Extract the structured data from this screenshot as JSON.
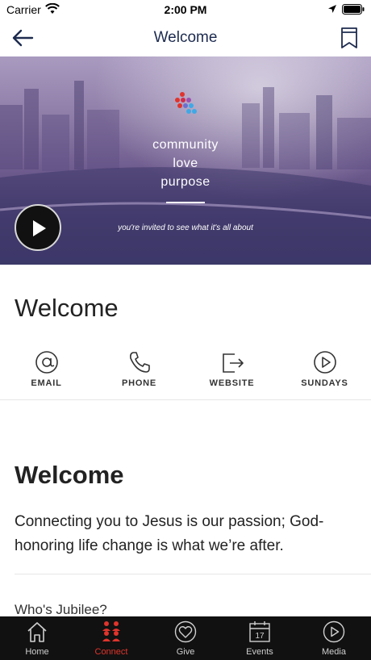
{
  "status_bar": {
    "carrier": "Carrier",
    "time": "2:00 PM"
  },
  "nav": {
    "title": "Welcome"
  },
  "hero": {
    "line1": "community",
    "line2": "love",
    "line3": "purpose",
    "invite": "you're invited to see what it's all about"
  },
  "welcome_heading": "Welcome",
  "actions": [
    {
      "label": "EMAIL",
      "icon": "at-icon"
    },
    {
      "label": "PHONE",
      "icon": "phone-icon"
    },
    {
      "label": "WEBSITE",
      "icon": "external-link-icon"
    },
    {
      "label": "SUNDAYS",
      "icon": "play-circle-icon"
    }
  ],
  "content": {
    "title": "Welcome",
    "body": "Connecting you to Jesus is our passion; God-honoring life change is what we’re after.",
    "next_heading": "Who's Jubilee?"
  },
  "tabs": [
    {
      "label": "Home",
      "icon": "home-icon",
      "active": false
    },
    {
      "label": "Connect",
      "icon": "people-icon",
      "active": true
    },
    {
      "label": "Give",
      "icon": "heart-icon",
      "active": false
    },
    {
      "label": "Events",
      "icon": "calendar-icon",
      "active": false,
      "calendar_day": "17"
    },
    {
      "label": "Media",
      "icon": "play-circle-icon",
      "active": false
    }
  ],
  "colors": {
    "accent": "#e0342c",
    "nav_title": "#1d2b4f",
    "tab_bar": "#111111"
  }
}
